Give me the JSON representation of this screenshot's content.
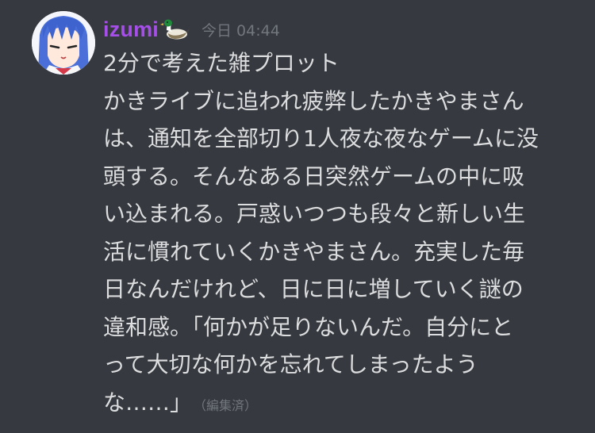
{
  "message": {
    "username": "izumi",
    "username_emoji": "duck-emoji",
    "timestamp": "今日 04:44",
    "title_line": "2分で考えた雑プロット",
    "body_lines": [
      "かきライブに追われ疲弊したかきやまさん",
      "は、通知を全部切り1人夜な夜なゲームに没",
      "頭する。そんなある日突然ゲームの中に吸",
      "い込まれる。戸惑いつつも段々と新しい生",
      "活に慣れていくかきやまさん。充実した毎",
      "日なんだけれど、日に日に増していく謎の",
      "違和感。「何かが足りないんだ。自分にと",
      "って大切な何かを忘れてしまったよう",
      "な……」"
    ],
    "edited_label": "（編集済）"
  },
  "colors": {
    "background": "#36393f",
    "username": "#a64fe8",
    "text": "#dcddde",
    "muted": "#72767d"
  }
}
